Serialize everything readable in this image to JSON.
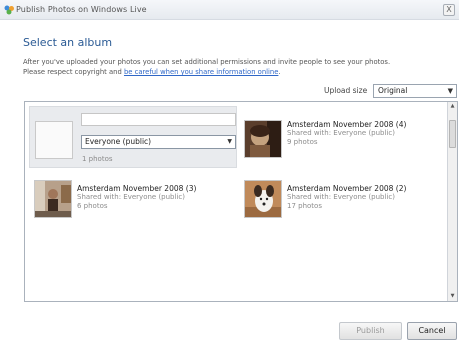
{
  "window": {
    "title": "Publish Photos on Windows Live",
    "close": "X"
  },
  "heading": "Select an album",
  "description": {
    "line1": "After you've uploaded your photos you can set additional permissions and invite people to see your photos.",
    "line2_prefix": "Please respect copyright and ",
    "line2_link": "be careful when you share information online",
    "line2_suffix": "."
  },
  "upload_size": {
    "label": "Upload size",
    "value": "Original"
  },
  "new_album": {
    "name_value": "",
    "permission_value": "Everyone (public)",
    "count": "1 photos"
  },
  "albums": [
    {
      "title": "Amsterdam November 2008 (4)",
      "shared": "Shared with: Everyone (public)",
      "count": "9 photos"
    },
    {
      "title": "Amsterdam November 2008 (3)",
      "shared": "Shared with: Everyone (public)",
      "count": "6 photos"
    },
    {
      "title": "Amsterdam November 2008 (2)",
      "shared": "Shared with: Everyone (public)",
      "count": "17 photos"
    }
  ],
  "buttons": {
    "publish": "Publish",
    "cancel": "Cancel"
  },
  "colors": {
    "heading": "#2a5a94",
    "link": "#2f67c7",
    "selection": "#e9ebee"
  }
}
